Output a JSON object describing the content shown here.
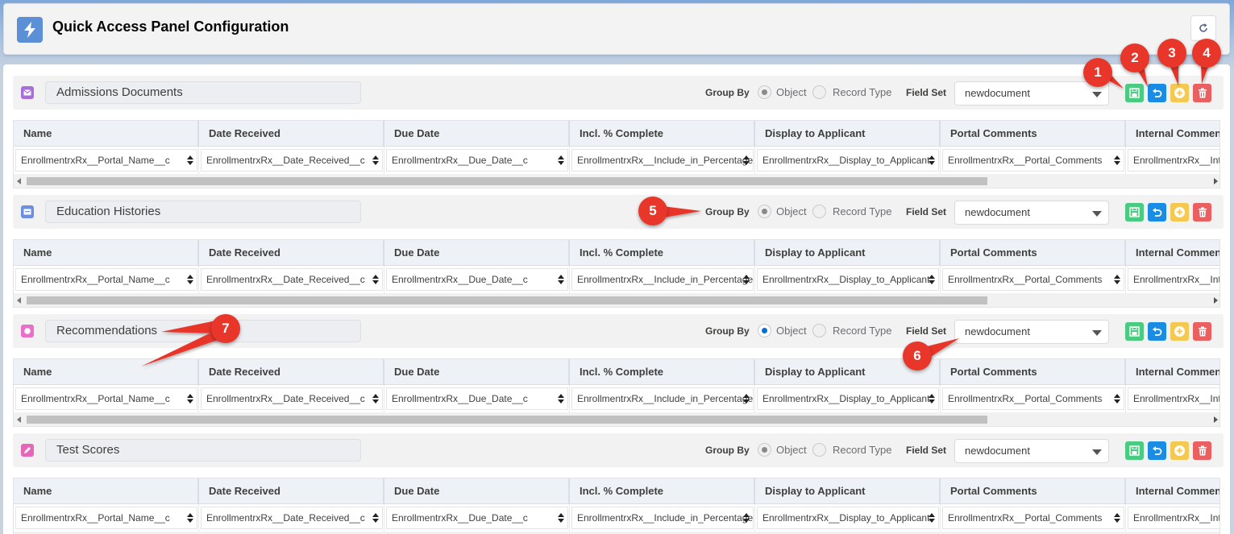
{
  "header": {
    "title": "Quick Access Panel Configuration"
  },
  "labels": {
    "group_by": "Group By",
    "object": "Object",
    "record_type": "Record Type",
    "field_set": "Field Set"
  },
  "columns": [
    "Name",
    "Date Received",
    "Due Date",
    "Incl. % Complete",
    "Display to Applicant",
    "Portal Comments",
    "Internal Comments"
  ],
  "values": [
    "EnrollmentrxRx__Portal_Name__c",
    "EnrollmentrxRx__Date_Received__c",
    "EnrollmentrxRx__Due_Date__c",
    "EnrollmentrxRx__Include_in_Percentage",
    "EnrollmentrxRx__Display_to_Applicant",
    "EnrollmentrxRx__Portal_Comments",
    "EnrollmentrxRx__Internal_Comments"
  ],
  "sections": [
    {
      "name": "Admissions Documents",
      "icon": "email-icon",
      "icon_color": "#a86fdb",
      "group_by": "object",
      "field_set": "newdocument"
    },
    {
      "name": "Education Histories",
      "icon": "card-icon",
      "icon_color": "#6d8fe0",
      "group_by": "object",
      "field_set": "newdocument"
    },
    {
      "name": "Recommendations",
      "icon": "circle-icon",
      "icon_color": "#ea6fc9",
      "group_by": "object",
      "field_set": "newdocument"
    },
    {
      "name": "Test Scores",
      "icon": "pencil-icon",
      "icon_color": "#e666b8",
      "group_by": "object",
      "field_set": "newdocument"
    }
  ],
  "annotations": [
    "1",
    "2",
    "3",
    "4",
    "5",
    "6",
    "7"
  ],
  "colors": {
    "save": "#4bca81",
    "undo": "#1b8ce3",
    "add": "#f4c951",
    "delete": "#ea6061",
    "badge": "#e8362b"
  }
}
